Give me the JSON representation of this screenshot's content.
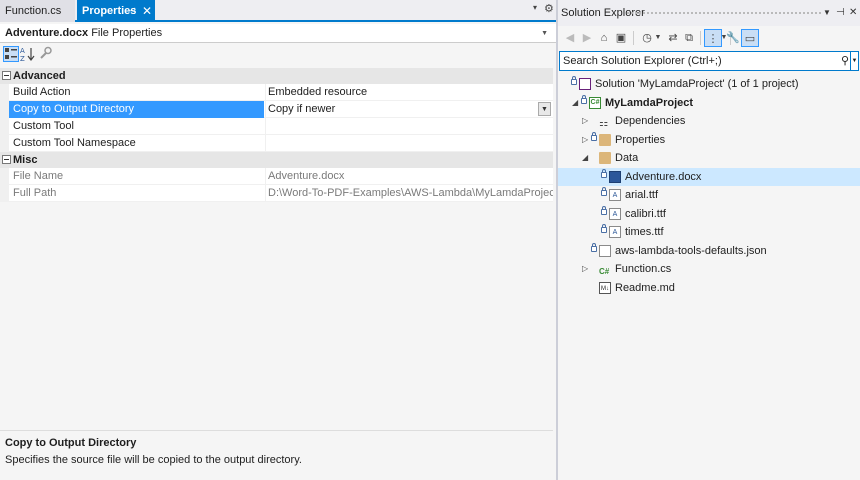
{
  "tabs": [
    {
      "label": "Function.cs",
      "active": false
    },
    {
      "label": "Properties",
      "active": true
    }
  ],
  "tab_controls": {
    "pin_glyph": "⊣",
    "close_glyph": "✕",
    "dropdown_glyph": "▾",
    "gear_glyph": "⚙"
  },
  "object_selector": {
    "name": "Adventure.docx",
    "type": "File Properties"
  },
  "property_toolbar": {
    "buttons": [
      "categorized-icon",
      "alphabetical-icon",
      "property-pages-icon"
    ],
    "selected": "categorized-icon"
  },
  "categories": [
    {
      "name": "Advanced",
      "rows": [
        {
          "name": "Build Action",
          "value": "Embedded resource",
          "selected": false,
          "readonly": false
        },
        {
          "name": "Copy to Output Directory",
          "value": "Copy if newer",
          "selected": true,
          "readonly": false
        },
        {
          "name": "Custom Tool",
          "value": "",
          "selected": false,
          "readonly": false
        },
        {
          "name": "Custom Tool Namespace",
          "value": "",
          "selected": false,
          "readonly": false
        }
      ]
    },
    {
      "name": "Misc",
      "rows": [
        {
          "name": "File Name",
          "value": "Adventure.docx",
          "selected": false,
          "readonly": true
        },
        {
          "name": "Full Path",
          "value": "D:\\Word-To-PDF-Examples\\AWS-Lambda\\MyLamdaProject\\MyLamdaProject\\Data\\Adventure.docx",
          "selected": false,
          "readonly": true
        }
      ]
    }
  ],
  "description": {
    "title": "Copy to Output Directory",
    "text": "Specifies the source file will be copied to the output directory."
  },
  "solution_explorer": {
    "title": "Solution Explorer",
    "search_placeholder": "Search Solution Explorer (Ctrl+;)",
    "tree": [
      {
        "label": "Solution 'MyLamdaProject' (1 of 1 project)",
        "level": 0,
        "icon": "solution-icon",
        "expander": "",
        "lock": true,
        "bold": false,
        "selected": false
      },
      {
        "label": "MyLamdaProject",
        "level": 1,
        "icon": "csharp-project-icon",
        "expander": "◢",
        "lock": true,
        "bold": true,
        "selected": false
      },
      {
        "label": "Dependencies",
        "level": 2,
        "icon": "dependencies-icon",
        "expander": "▷",
        "lock": false,
        "bold": false,
        "selected": false
      },
      {
        "label": "Properties",
        "level": 2,
        "icon": "wrench-folder-icon",
        "expander": "▷",
        "lock": true,
        "bold": false,
        "selected": false
      },
      {
        "label": "Data",
        "level": 2,
        "icon": "folder-icon",
        "expander": "◢",
        "lock": false,
        "bold": false,
        "selected": false
      },
      {
        "label": "Adventure.docx",
        "level": 3,
        "icon": "word-document-icon",
        "expander": "",
        "lock": true,
        "bold": false,
        "selected": true
      },
      {
        "label": "arial.ttf",
        "level": 3,
        "icon": "font-file-icon",
        "expander": "",
        "lock": true,
        "bold": false,
        "selected": false
      },
      {
        "label": "calibri.ttf",
        "level": 3,
        "icon": "font-file-icon",
        "expander": "",
        "lock": true,
        "bold": false,
        "selected": false
      },
      {
        "label": "times.ttf",
        "level": 3,
        "icon": "font-file-icon",
        "expander": "",
        "lock": true,
        "bold": false,
        "selected": false
      },
      {
        "label": "aws-lambda-tools-defaults.json",
        "level": 2,
        "icon": "json-file-icon",
        "expander": "",
        "lock": true,
        "bold": false,
        "selected": false
      },
      {
        "label": "Function.cs",
        "level": 2,
        "icon": "csharp-file-icon",
        "expander": "▷",
        "lock": false,
        "bold": false,
        "selected": false
      },
      {
        "label": "Readme.md",
        "level": 2,
        "icon": "markdown-file-icon",
        "expander": "",
        "lock": false,
        "bold": false,
        "selected": false
      }
    ]
  },
  "colors": {
    "accent": "#007acc",
    "selection": "#3399ff",
    "tree_selection": "#cce8ff"
  }
}
